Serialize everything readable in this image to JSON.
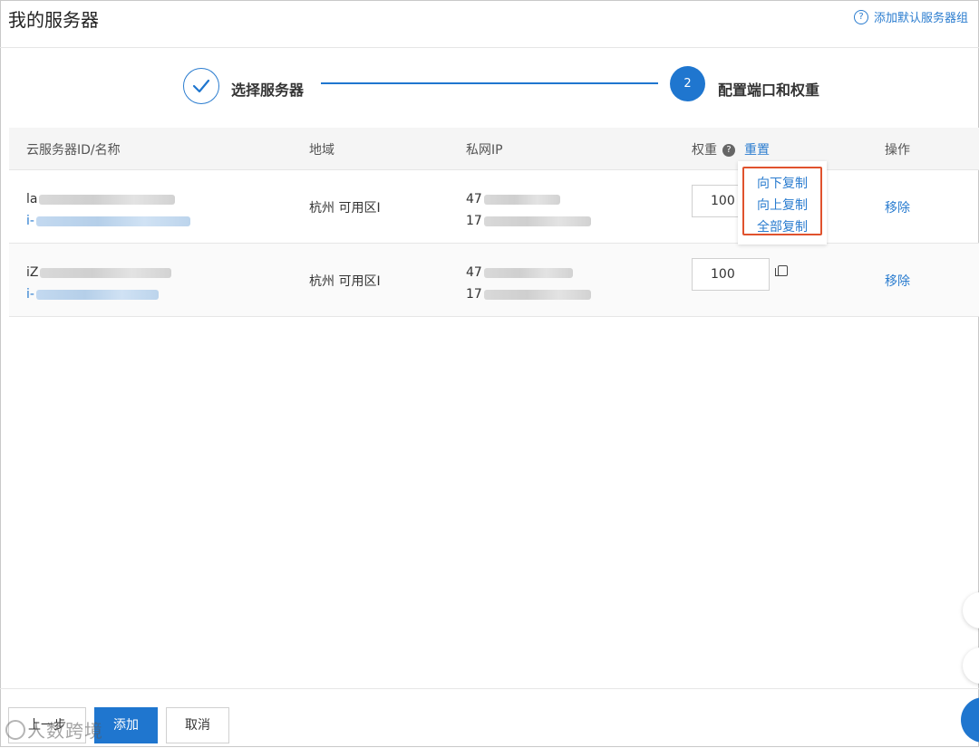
{
  "header": {
    "title": "我的服务器",
    "help_link": "添加默认服务器组"
  },
  "steps": [
    {
      "label": "选择服务器",
      "state": "done"
    },
    {
      "number": "2",
      "label": "配置端口和权重",
      "state": "active"
    }
  ],
  "table": {
    "columns": {
      "name": "云服务器ID/名称",
      "region": "地域",
      "ip": "私网IP",
      "weight": "权重",
      "reset": "重置",
      "action": "操作"
    },
    "rows": [
      {
        "name_prefix": "la",
        "id_prefix": "i-",
        "region": "杭州 可用区I",
        "ip1_prefix": "47",
        "ip2_prefix": "17",
        "weight": "100",
        "action": "移除"
      },
      {
        "name_prefix": "iZ",
        "id_prefix": "i-",
        "region": "杭州 可用区I",
        "ip1_prefix": "47",
        "ip2_prefix": "17",
        "weight": "100",
        "action": "移除"
      }
    ]
  },
  "copy_menu": {
    "items": [
      "向下复制",
      "向上复制",
      "全部复制"
    ],
    "highlight_color": "#e0522d"
  },
  "footer": {
    "prev": "上一步",
    "add": "添加",
    "cancel": "取消",
    "watermark": "人数跨境"
  },
  "colors": {
    "primary": "#1f76cf",
    "link": "#2a7ccf"
  },
  "icons": {
    "help": "question-circle-icon",
    "step_done": "check-icon",
    "copy": "copy-icon"
  }
}
